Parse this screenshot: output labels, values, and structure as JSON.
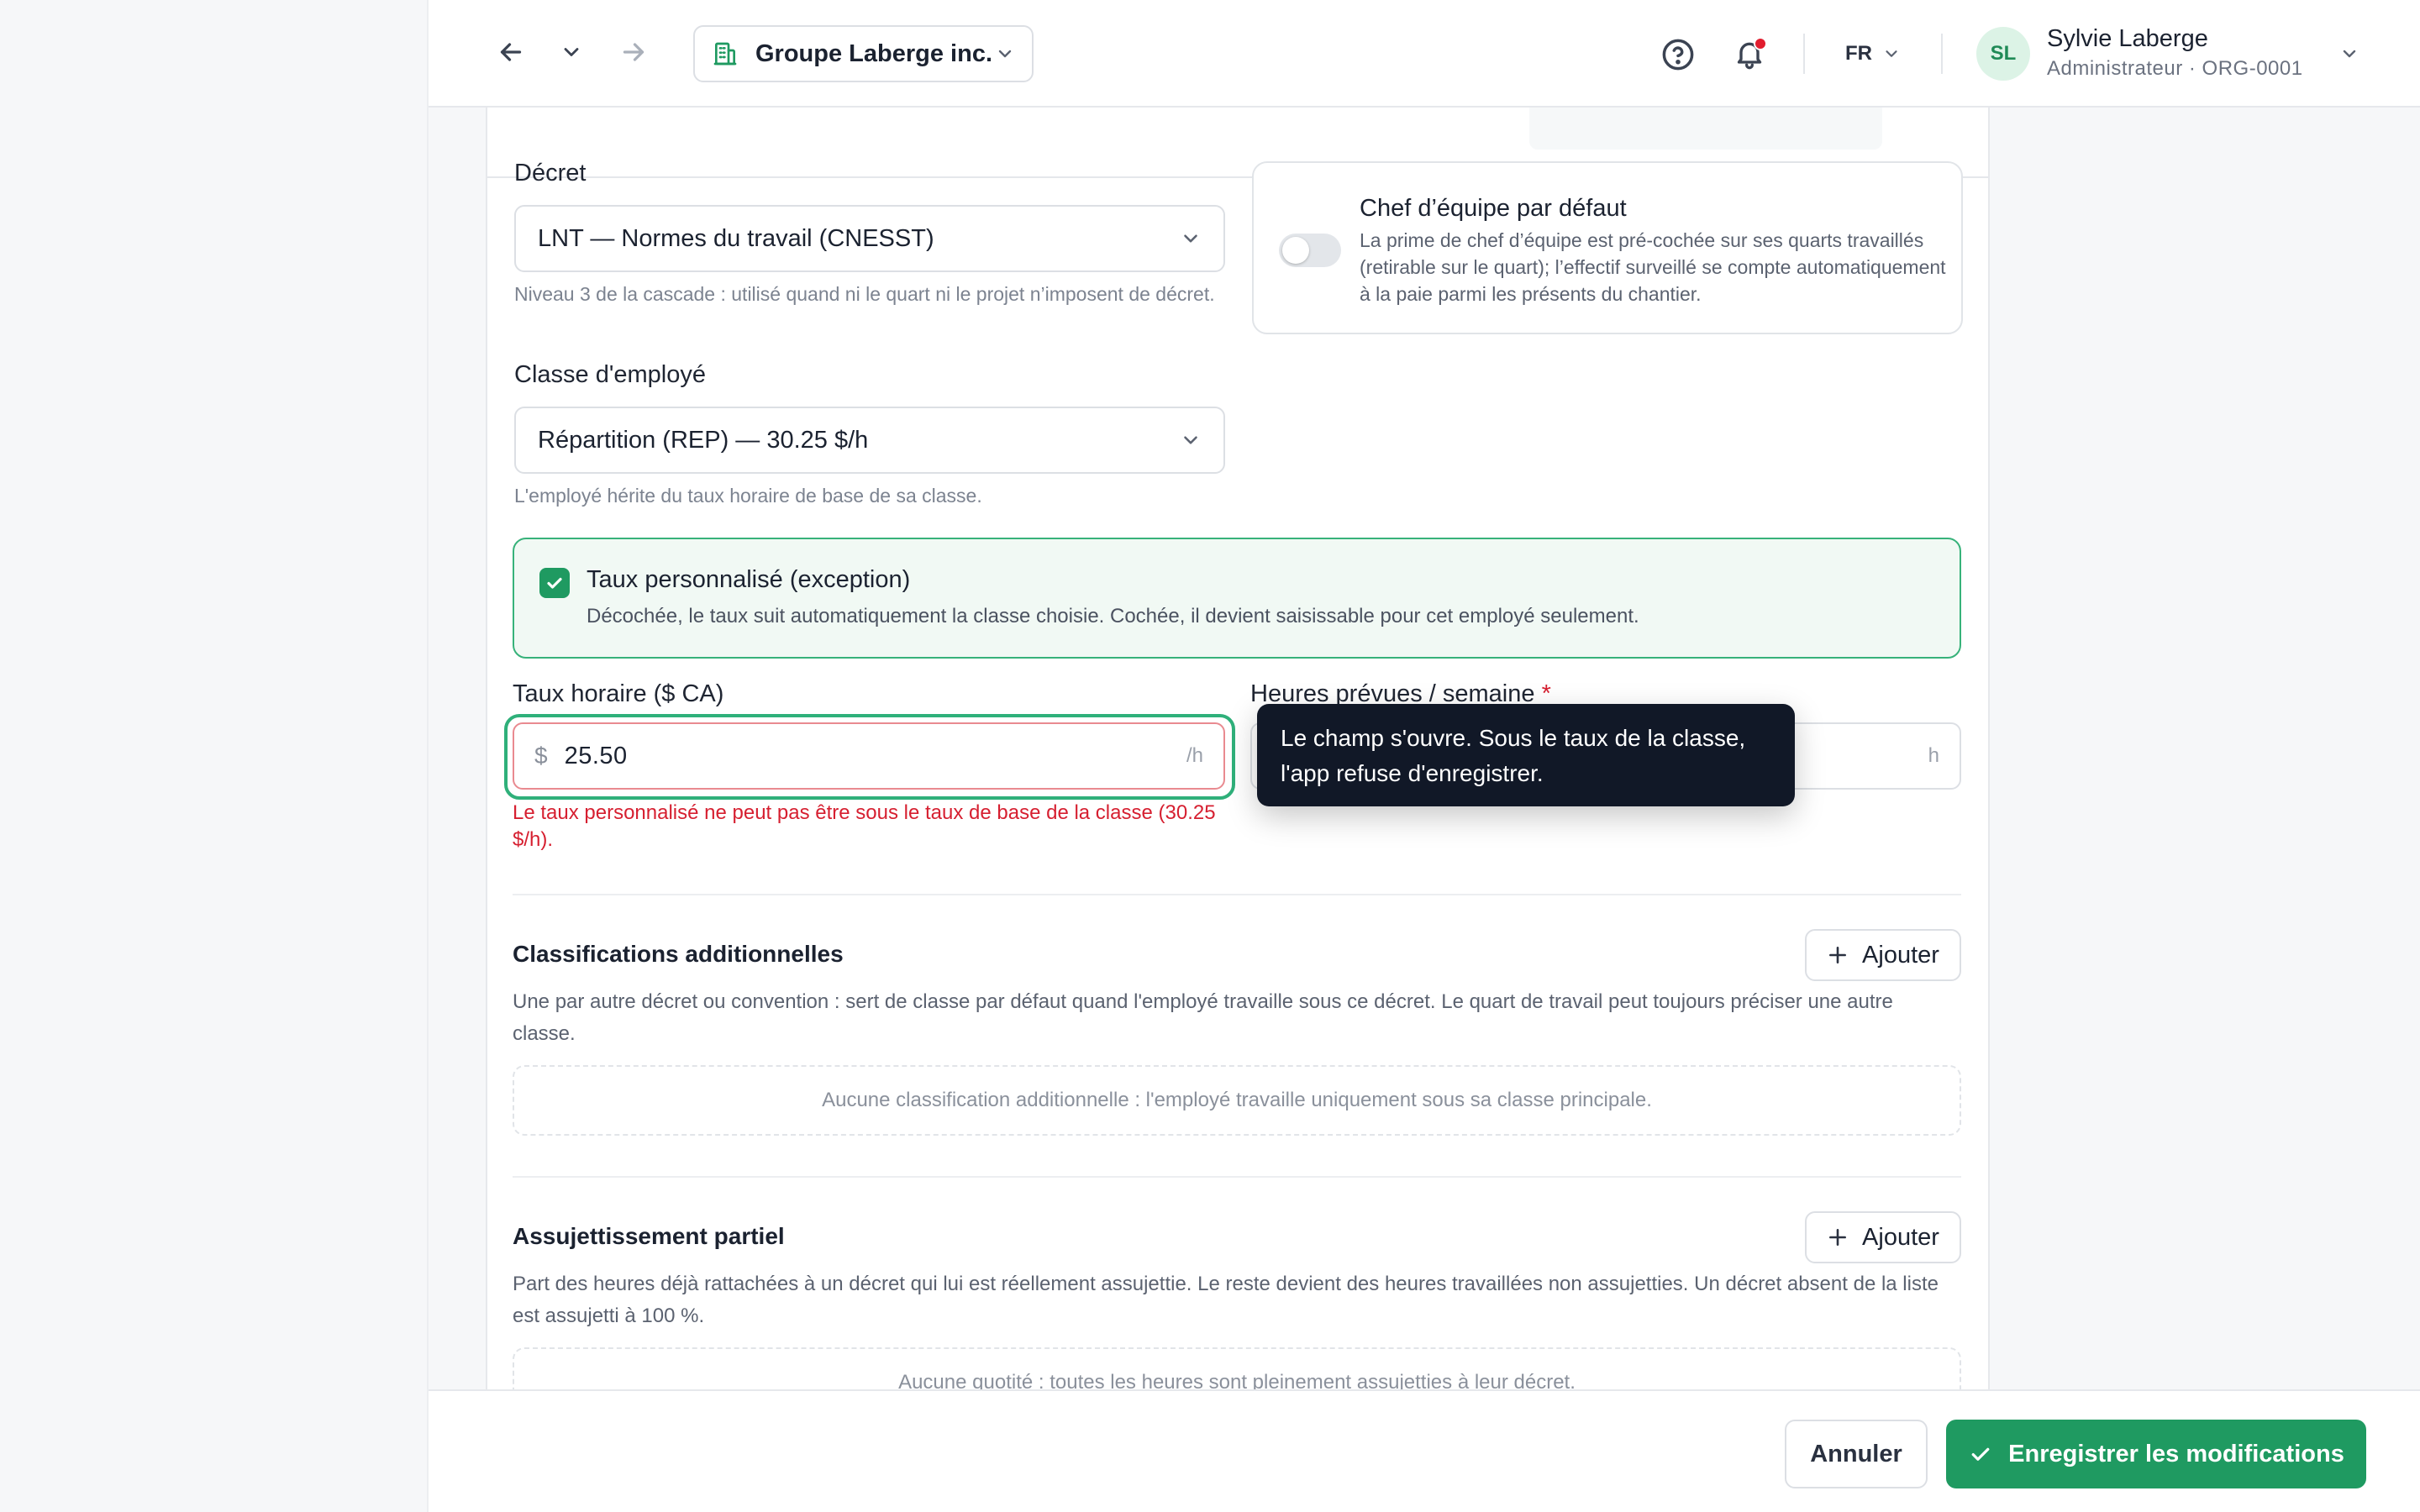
{
  "topbar": {
    "org_name": "Groupe Laberge inc.",
    "language": "FR",
    "user": {
      "initials": "SL",
      "name": "Sylvie Laberge",
      "role": "Administrateur · ORG-0001"
    },
    "notification_dot": true
  },
  "form": {
    "decree": {
      "label": "Décret",
      "value": "LNT — Normes du travail (CNESST)",
      "help": "Niveau 3 de la cascade : utilisé quand ni le quart ni le projet n’imposent de décret."
    },
    "team_lead": {
      "title": "Chef d’équipe par défaut",
      "description": "La prime de chef d’équipe est pré-cochée sur ses quarts travaillés (retirable sur le quart); l’effectif surveillé se compte automatiquement à la paie parmi les présents du chantier.",
      "enabled": false
    },
    "employee_class": {
      "label": "Classe d'employé",
      "value": "Répartition (REP) — 30.25 $/h",
      "help": "L'employé hérite du taux horaire de base de sa classe."
    },
    "custom_rate": {
      "title": "Taux personnalisé (exception)",
      "description": "Décochée, le taux suit automatiquement la classe choisie. Cochée, il devient saisissable pour cet employé seulement.",
      "checked": true
    },
    "hourly_rate": {
      "label": "Taux horaire ($ CA)",
      "currency": "$",
      "value": "25.50",
      "unit": "/h",
      "error": "Le taux personnalisé ne peut pas être sous le taux de base de la classe (30.25 $/h)."
    },
    "weekly_hours": {
      "label": "Heures prévues / semaine",
      "required_mark": "*",
      "unit": "h"
    },
    "tooltip": "Le champ s'ouvre. Sous le taux de la classe, l'app refuse d'enregistrer."
  },
  "sections": {
    "classifications": {
      "title": "Classifications additionnelles",
      "add_label": "Ajouter",
      "description": "Une par autre décret ou convention : sert de classe par défaut quand l'employé travaille sous ce décret. Le quart de travail peut toujours préciser une autre classe.",
      "empty": "Aucune classification additionnelle : l'employé travaille uniquement sous sa classe principale."
    },
    "partial": {
      "title": "Assujettissement partiel",
      "add_label": "Ajouter",
      "description": "Part des heures déjà rattachées à un décret qui lui est réellement assujettie. Le reste devient des heures travaillées non assujetties. Un décret absent de la liste est assujetti à 100 %.",
      "empty": "Aucune quotité : toutes les heures sont pleinement assujetties à leur décret."
    }
  },
  "footer": {
    "cancel": "Annuler",
    "save": "Enregistrer les modifications"
  },
  "colors": {
    "accent": "#1f9a61",
    "error": "#d61f30",
    "tooltip_bg": "#111827"
  }
}
